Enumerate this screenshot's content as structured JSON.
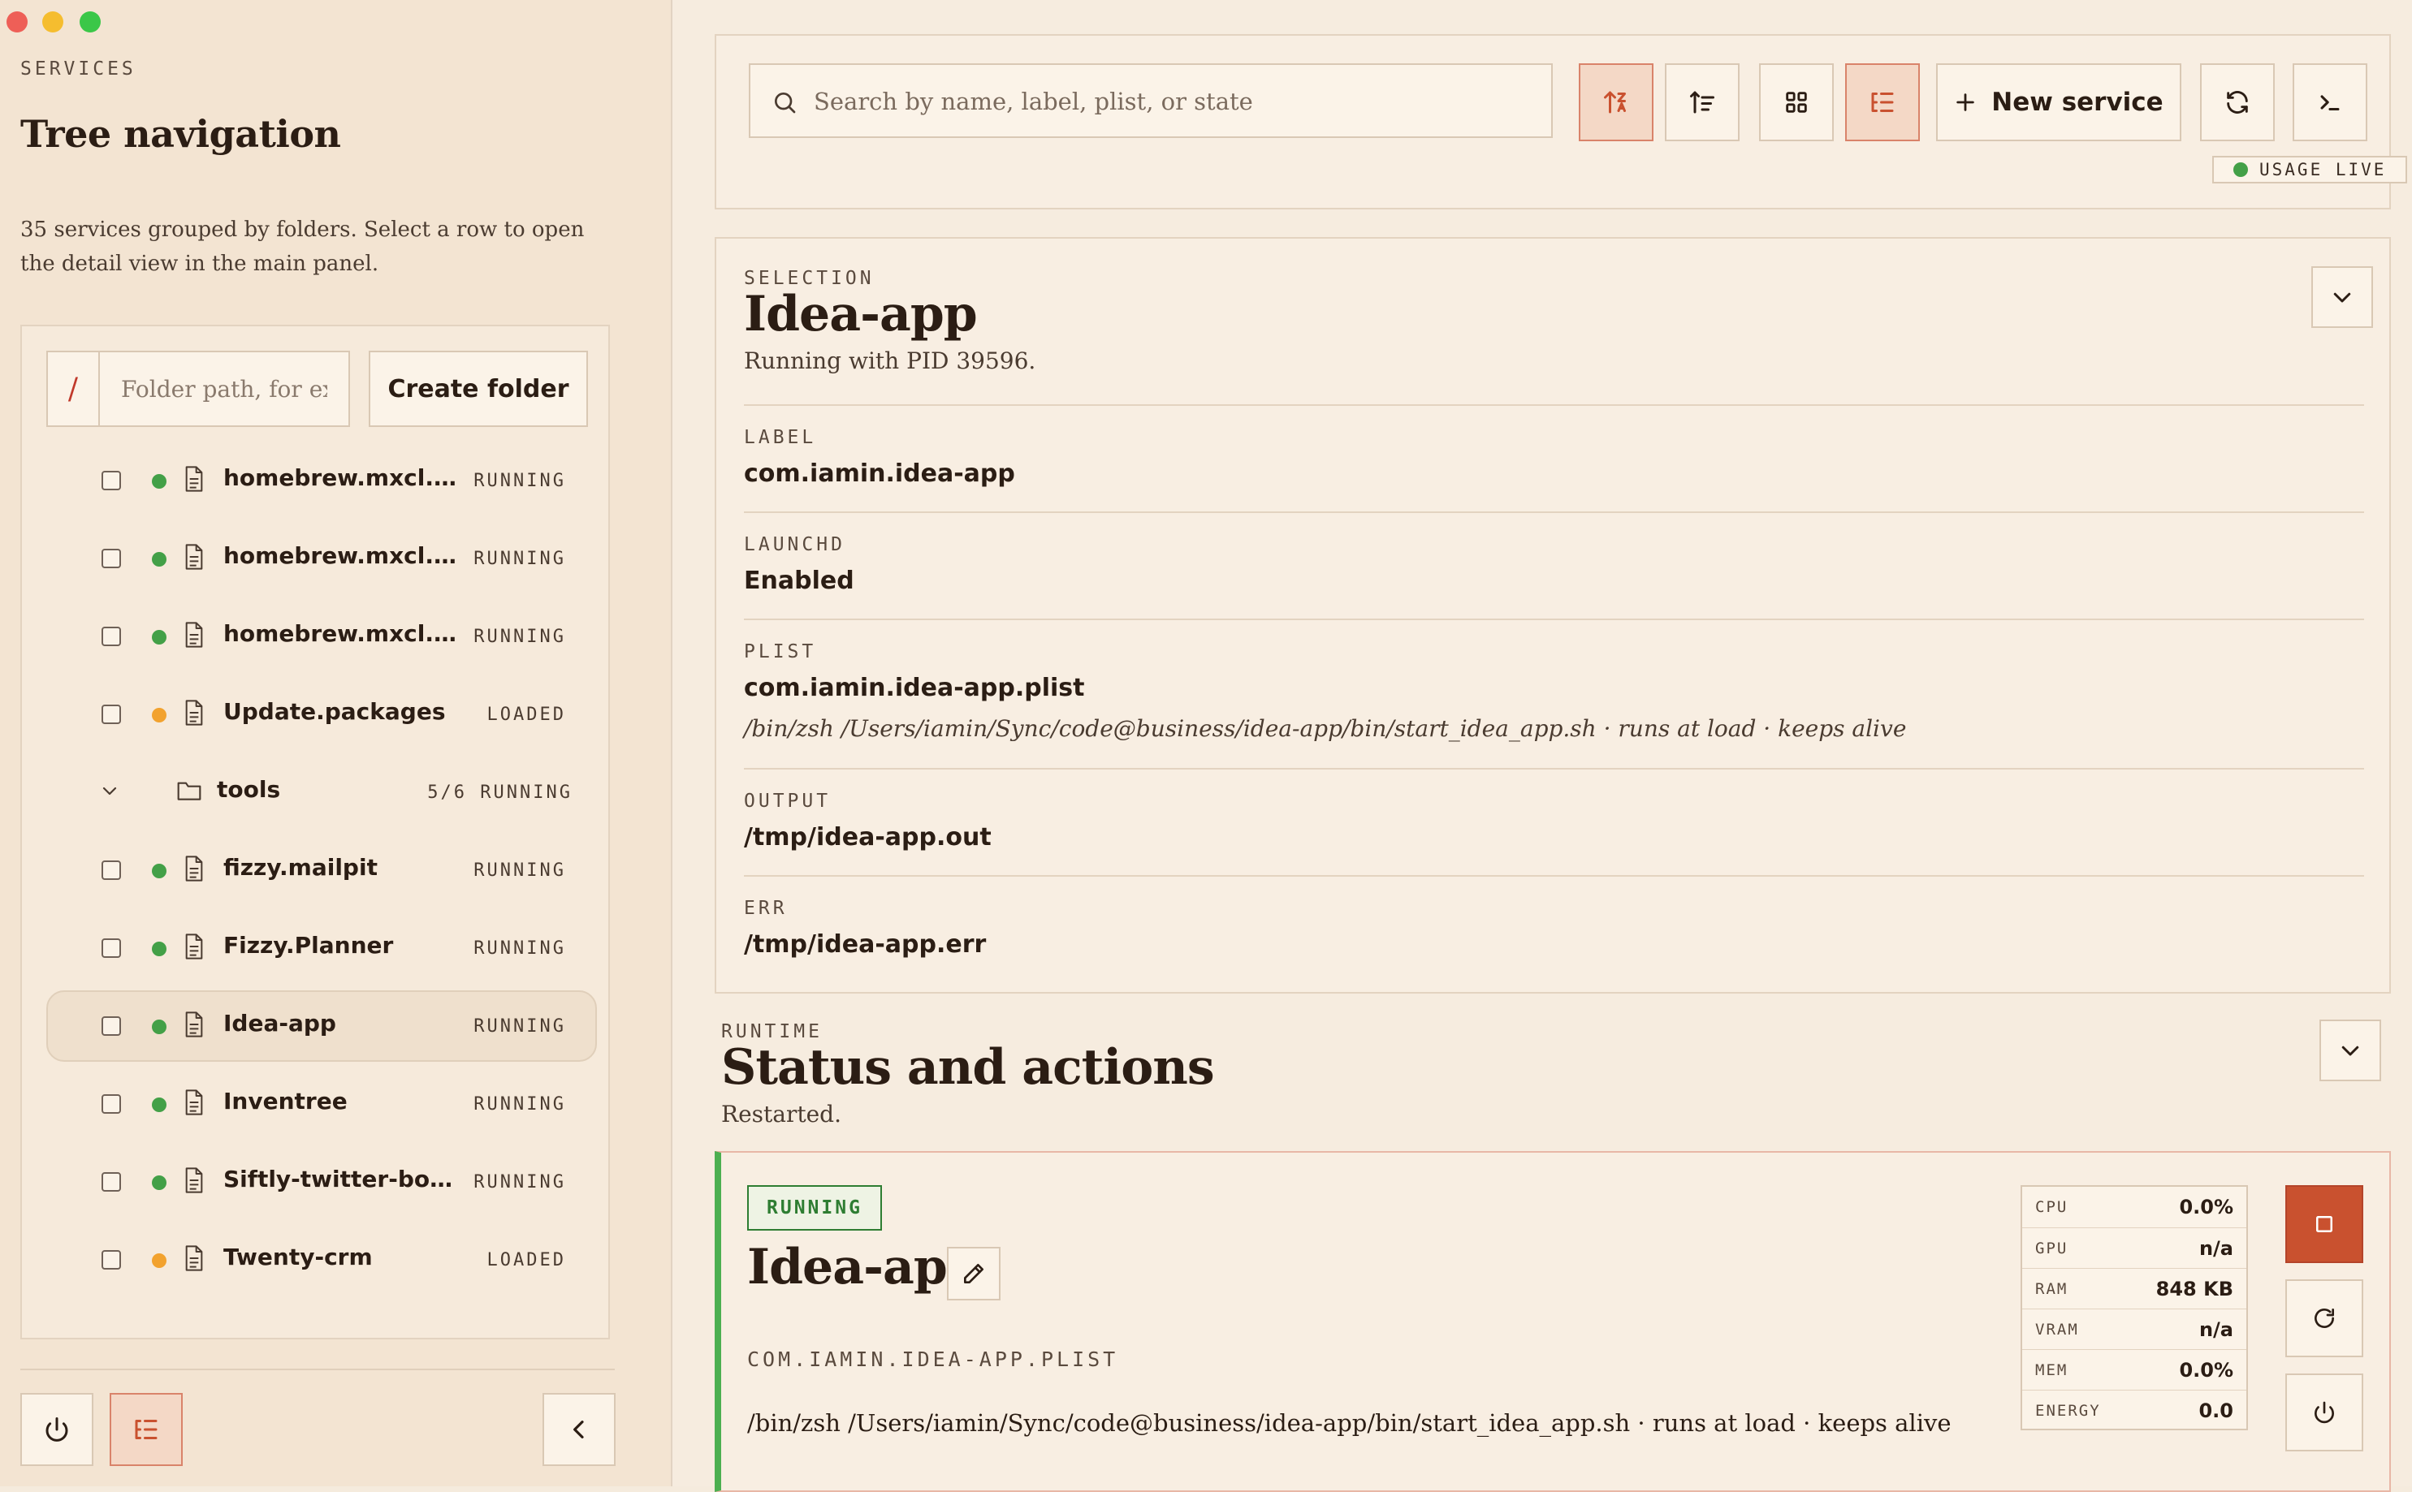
{
  "window": {
    "traffic_lights": [
      "#ee5f57",
      "#f5bd2f",
      "#3bc748"
    ]
  },
  "sidebar": {
    "section": "SERVICES",
    "title": "Tree navigation",
    "description": "35 services grouped by folders. Select a row to open the detail view in the main panel.",
    "folder_prefix": "/",
    "folder_placeholder": "Folder path, for example",
    "create_folder_label": "Create folder",
    "rows": [
      {
        "type": "service",
        "name": "homebrew.mxcl.php",
        "state": "RUNNING",
        "status_color": "#43a047",
        "selected": false
      },
      {
        "type": "service",
        "name": "homebrew.mxcl.p...",
        "state": "RUNNING",
        "status_color": "#43a047",
        "selected": false
      },
      {
        "type": "service",
        "name": "homebrew.mxcl.re...",
        "state": "RUNNING",
        "status_color": "#43a047",
        "selected": false
      },
      {
        "type": "service",
        "name": "Update.packages",
        "state": "LOADED",
        "status_color": "#f2a22e",
        "selected": false
      },
      {
        "type": "folder",
        "name": "tools",
        "count": "5/6 RUNNING"
      },
      {
        "type": "service",
        "name": "fizzy.mailpit",
        "state": "RUNNING",
        "status_color": "#43a047",
        "selected": false
      },
      {
        "type": "service",
        "name": "Fizzy.Planner",
        "state": "RUNNING",
        "status_color": "#43a047",
        "selected": false
      },
      {
        "type": "service",
        "name": "Idea-app",
        "state": "RUNNING",
        "status_color": "#43a047",
        "selected": true
      },
      {
        "type": "service",
        "name": "Inventree",
        "state": "RUNNING",
        "status_color": "#43a047",
        "selected": false
      },
      {
        "type": "service",
        "name": "Siftly-twitter-boo...",
        "state": "RUNNING",
        "status_color": "#43a047",
        "selected": false
      },
      {
        "type": "service",
        "name": "Twenty-crm",
        "state": "LOADED",
        "status_color": "#f2a22e",
        "selected": false
      }
    ]
  },
  "toolbar": {
    "search_placeholder": "Search by name, label, plist, or state",
    "new_service_label": "New service",
    "usage_live_label": "USAGE LIVE"
  },
  "selection": {
    "eyebrow": "SELECTION",
    "title": "Idea-app",
    "subtitle": "Running with PID 39596.",
    "fields": {
      "label": {
        "label": "LABEL",
        "value": "com.iamin.idea-app"
      },
      "launchd": {
        "label": "LAUNCHD",
        "value": "Enabled"
      },
      "plist": {
        "label": "PLIST",
        "value": "com.iamin.idea-app.plist",
        "note": "/bin/zsh /Users/iamin/Sync/code@business/idea-app/bin/start_idea_app.sh · runs at load · keeps alive"
      },
      "output": {
        "label": "OUTPUT",
        "value": "/tmp/idea-app.out"
      },
      "err": {
        "label": "ERR",
        "value": "/tmp/idea-app.err"
      }
    }
  },
  "runtime": {
    "eyebrow": "RUNTIME",
    "title": "Status and actions",
    "subtitle": "Restarted.",
    "status_badge": "RUNNING",
    "service_title": "Idea-app",
    "plist_caps": "COM.IAMIN.IDEA-APP.PLIST",
    "command": "/bin/zsh /Users/iamin/Sync/code@business/idea-app/bin/start_idea_app.sh · runs at load · keeps alive",
    "metrics": [
      {
        "name": "CPU",
        "value": "0.0%"
      },
      {
        "name": "GPU",
        "value": "n/a"
      },
      {
        "name": "RAM",
        "value": "848 KB"
      },
      {
        "name": "VRAM",
        "value": "n/a"
      },
      {
        "name": "MEM",
        "value": "0.0%"
      },
      {
        "name": "ENERGY",
        "value": "0.0"
      }
    ]
  },
  "colors": {
    "accent": "#c9512f",
    "running": "#43a047",
    "loaded": "#f2a22e"
  }
}
